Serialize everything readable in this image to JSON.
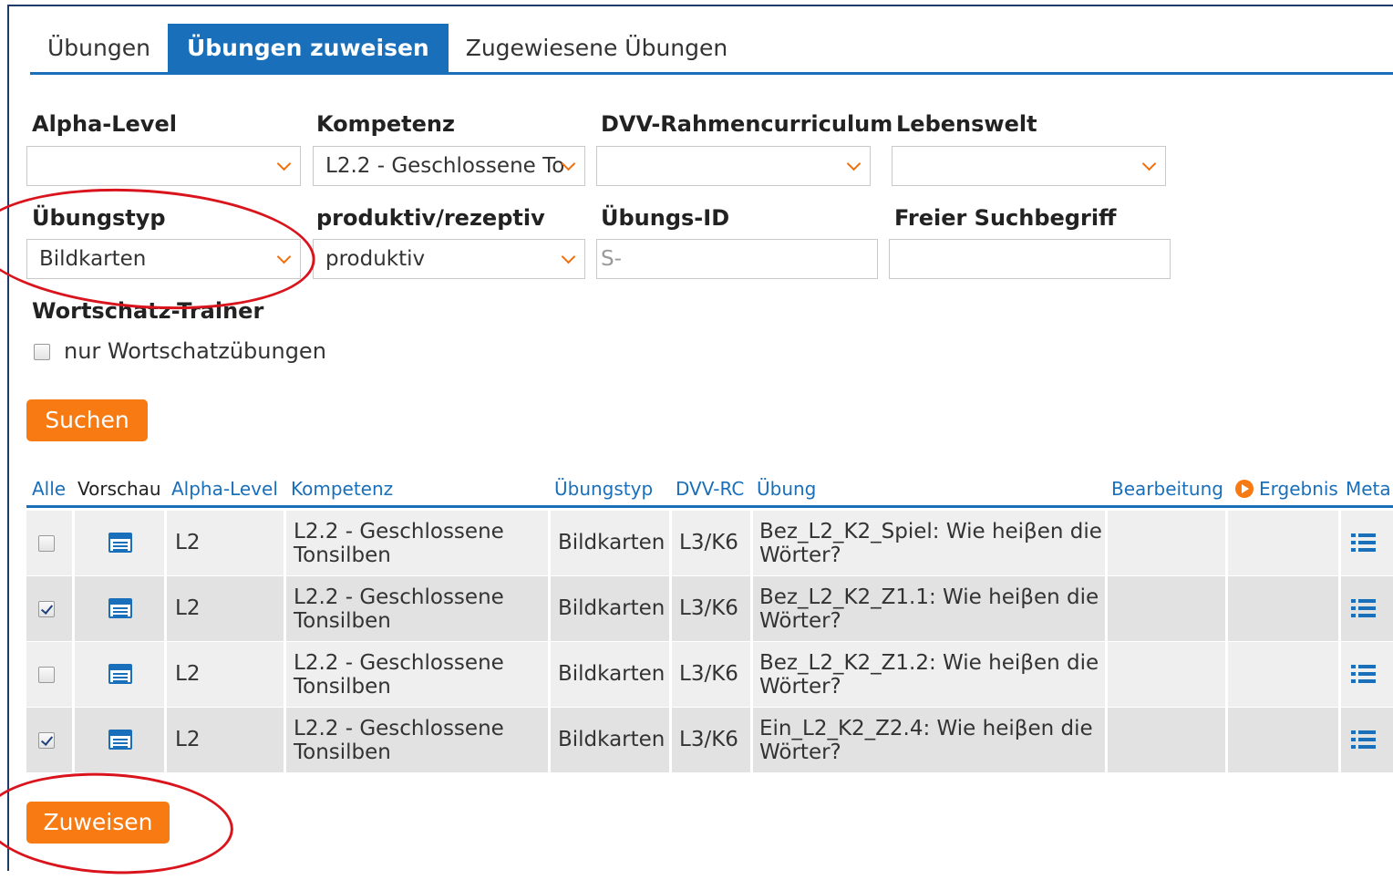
{
  "tabs": [
    "Übungen",
    "Übungen zuweisen",
    "Zugewiesene Übungen"
  ],
  "active_tab": "Übungen zuweisen",
  "filters": {
    "alpha_level": {
      "label": "Alpha-Level",
      "value": ""
    },
    "kompetenz": {
      "label": "Kompetenz",
      "value": "L2.2 - Geschlossene To"
    },
    "dvv": {
      "label": "DVV-Rahmencurriculum",
      "value": ""
    },
    "lebenswelt": {
      "label": "Lebenswelt",
      "value": ""
    },
    "uebungstyp": {
      "label": "Übungstyp",
      "value": "Bildkarten"
    },
    "produktiv": {
      "label": "produktiv/rezeptiv",
      "value": "produktiv"
    },
    "uebungs_id": {
      "label": "Übungs-ID",
      "placeholder": "S-"
    },
    "freier": {
      "label": "Freier Suchbegriff",
      "value": ""
    }
  },
  "wortschatz": {
    "heading": "Wortschatz-Trainer",
    "checkbox_label": "nur Wortschatzübungen",
    "checked": false
  },
  "search_button": "Suchen",
  "table": {
    "headers": {
      "alle": "Alle",
      "vorschau": "Vorschau",
      "alpha": "Alpha-Level",
      "kompetenz": "Kompetenz",
      "typ": "Übungstyp",
      "dvv": "DVV-RC",
      "uebung": "Übung",
      "bearbeitung": "Bearbeitung",
      "ergebnis": "Ergebnis",
      "meta": "Meta"
    },
    "rows": [
      {
        "checked": false,
        "alpha": "L2",
        "komp1": "L2.2 - Geschlossene",
        "komp2": "Tonsilben",
        "typ": "Bildkarten",
        "dvv": "L3/K6",
        "ueb1": "Bez_L2_K2_Spiel: Wie heiβen die",
        "ueb2": "Wörter?"
      },
      {
        "checked": true,
        "alpha": "L2",
        "komp1": "L2.2 - Geschlossene",
        "komp2": "Tonsilben",
        "typ": "Bildkarten",
        "dvv": "L3/K6",
        "ueb1": "Bez_L2_K2_Z1.1: Wie heiβen die",
        "ueb2": "Wörter?"
      },
      {
        "checked": false,
        "alpha": "L2",
        "komp1": "L2.2 - Geschlossene",
        "komp2": "Tonsilben",
        "typ": "Bildkarten",
        "dvv": "L3/K6",
        "ueb1": "Bez_L2_K2_Z1.2: Wie heiβen die",
        "ueb2": "Wörter?"
      },
      {
        "checked": true,
        "alpha": "L2",
        "komp1": "L2.2 - Geschlossene",
        "komp2": "Tonsilben",
        "typ": "Bildkarten",
        "dvv": "L3/K6",
        "ueb1": "Ein_L2_K2_Z2.4: Wie heiβen die",
        "ueb2": "Wörter?"
      }
    ]
  },
  "assign_button": "Zuweisen",
  "colors": {
    "accent_blue": "#1a6fba",
    "orange": "#f77a12",
    "annotation_red": "#d9141c"
  }
}
